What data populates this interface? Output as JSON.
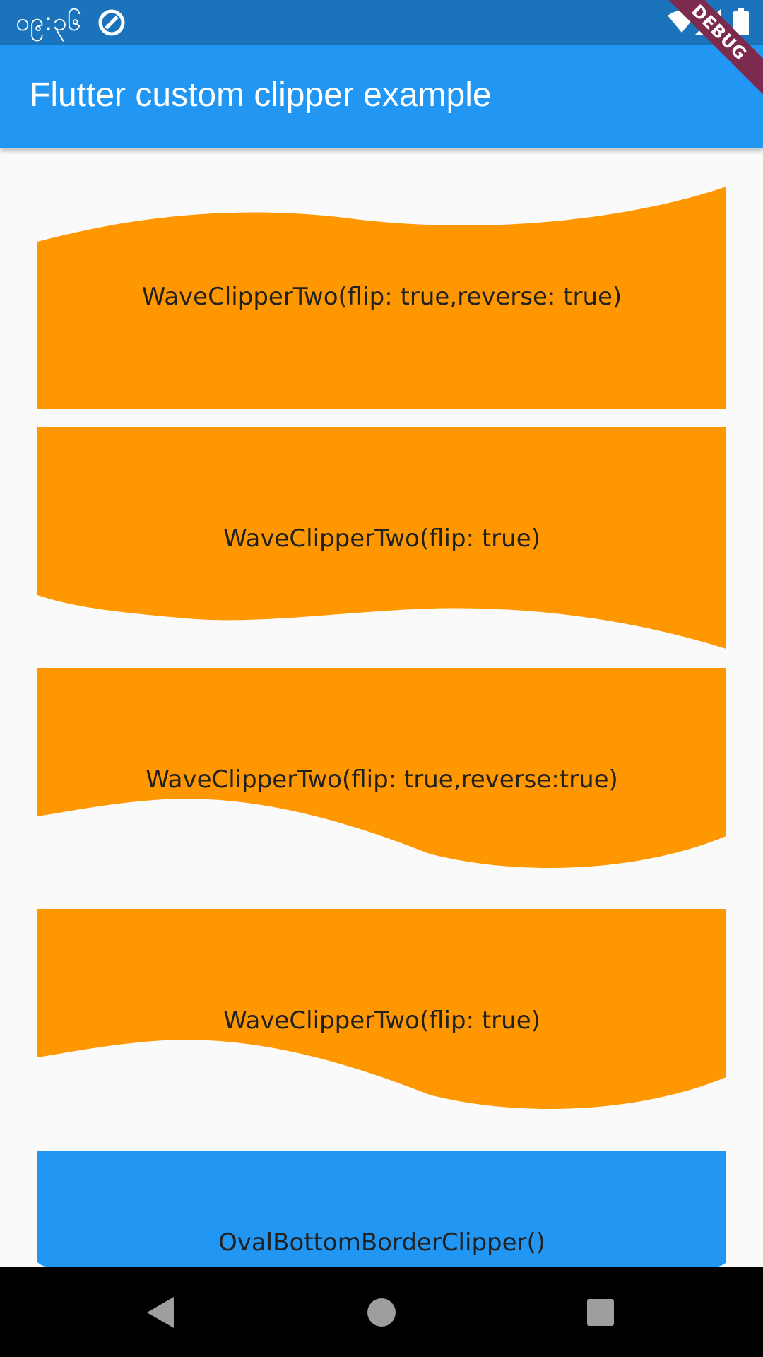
{
  "status_bar": {
    "time": "၀၉:၃၆",
    "icons": [
      "app-notification-icon",
      "wifi-icon",
      "signal-icon",
      "battery-icon"
    ]
  },
  "app_bar": {
    "title": "Flutter custom clipper example"
  },
  "debug_banner": {
    "label": "DEBUG"
  },
  "cards": [
    {
      "label": "WaveClipperTwo(flip: true,reverse: true)",
      "color": "#ff9800"
    },
    {
      "label": "WaveClipperTwo(flip: true)",
      "color": "#ff9800"
    },
    {
      "label": "WaveClipperTwo(flip: true,reverse:true)",
      "color": "#ff9800"
    },
    {
      "label": "WaveClipperTwo(flip: true)",
      "color": "#ff9800"
    },
    {
      "label": "OvalBottomBorderClipper()",
      "color": "#2196f3"
    }
  ],
  "nav_bar": {
    "icons": [
      "back-icon",
      "home-icon",
      "recents-icon"
    ]
  },
  "colors": {
    "status_bar": "#1b74bb",
    "app_bar": "#2196f3",
    "orange": "#ff9800",
    "background": "#fafafa",
    "debug": "#7d2a4f"
  }
}
